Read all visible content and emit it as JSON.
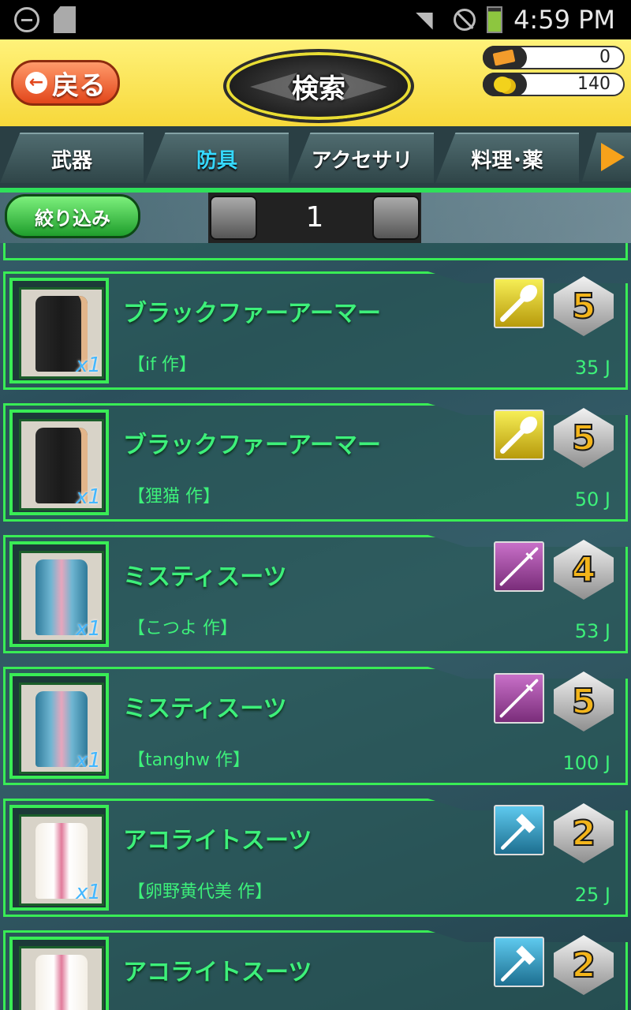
{
  "status_bar": {
    "time": "4:59 PM"
  },
  "header": {
    "back_label": "戻る",
    "title": "検索",
    "tickets": "0",
    "coins": "140"
  },
  "tabs": [
    {
      "label": "武器",
      "active": false
    },
    {
      "label": "防具",
      "active": true
    },
    {
      "label": "アクセサリ",
      "active": false
    },
    {
      "label": "料理･薬",
      "active": false
    }
  ],
  "filter": {
    "label": "絞り込み",
    "page": "1"
  },
  "items": [
    {
      "name": "ブラックファーアーマー",
      "author": "【if 作】",
      "price": "35 J",
      "qty": "x1",
      "type_color": "gold",
      "type_icon": "spatula-icon",
      "rank": "5",
      "outfit": "black-armor"
    },
    {
      "name": "ブラックファーアーマー",
      "author": "【狸猫 作】",
      "price": "50 J",
      "qty": "x1",
      "type_color": "gold",
      "type_icon": "spatula-icon",
      "rank": "5",
      "outfit": "black-armor"
    },
    {
      "name": "ミスティスーツ",
      "author": "【こつよ 作】",
      "price": "53 J",
      "qty": "x1",
      "type_color": "purple",
      "type_icon": "needle-icon",
      "rank": "4",
      "outfit": "misty-suit"
    },
    {
      "name": "ミスティスーツ",
      "author": "【tanghw 作】",
      "price": "100 J",
      "qty": "x1",
      "type_color": "purple",
      "type_icon": "needle-icon",
      "rank": "5",
      "outfit": "misty-suit"
    },
    {
      "name": "アコライトスーツ",
      "author": "【卵野黄代美 作】",
      "price": "25 J",
      "qty": "x1",
      "type_color": "blue",
      "type_icon": "hammer-icon",
      "rank": "2",
      "outfit": "acolyte-suit"
    },
    {
      "name": "アコライトスーツ",
      "author": "",
      "price": "",
      "qty": "",
      "type_color": "blue",
      "type_icon": "hammer-icon",
      "rank": "2",
      "outfit": "acolyte-suit"
    }
  ]
}
